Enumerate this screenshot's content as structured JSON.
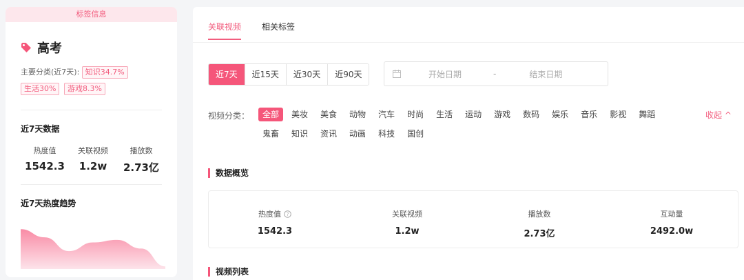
{
  "left": {
    "header": "标签信息",
    "tag_name": "高考",
    "category_prefix": "主要分类(近7天):",
    "category_chips": [
      "知识34.7%",
      "生活30%",
      "游戏8.3%"
    ],
    "seven_day_title": "近7天数据",
    "stats": [
      {
        "label": "热度值",
        "value": "1542.3"
      },
      {
        "label": "关联视频",
        "value": "1.2w"
      },
      {
        "label": "播放数",
        "value": "2.73亿"
      }
    ],
    "trend_title": "近7天热度趋势",
    "trend_values": [
      0.78,
      0.62,
      0.35,
      0.52,
      0.57,
      0.4,
      0.05
    ],
    "accent": "#f5567a"
  },
  "right": {
    "tabs": [
      "关联视频",
      "相关标签"
    ],
    "active_tab": 0,
    "ranges": [
      "近7天",
      "近15天",
      "近30天",
      "近90天"
    ],
    "active_range": 0,
    "date_start_placeholder": "开始日期",
    "date_sep": "-",
    "date_end_placeholder": "结束日期",
    "category_label": "视频分类：",
    "categories_row1": [
      "全部",
      "美妆",
      "美食",
      "动物",
      "汽车",
      "时尚",
      "生活",
      "运动",
      "游戏",
      "数码",
      "娱乐",
      "音乐",
      "影视",
      "舞蹈"
    ],
    "categories_row2": [
      "鬼畜",
      "知识",
      "资讯",
      "动画",
      "科技",
      "国创"
    ],
    "active_category": "全部",
    "collapse_label": "收起",
    "overview_title": "数据概览",
    "overview": [
      {
        "label": "热度值",
        "value": "1542.3",
        "info_icon": true
      },
      {
        "label": "关联视频",
        "value": "1.2w"
      },
      {
        "label": "播放数",
        "value": "2.73亿"
      },
      {
        "label": "互动量",
        "value": "2492.0w"
      }
    ],
    "video_list_title": "视频列表"
  }
}
